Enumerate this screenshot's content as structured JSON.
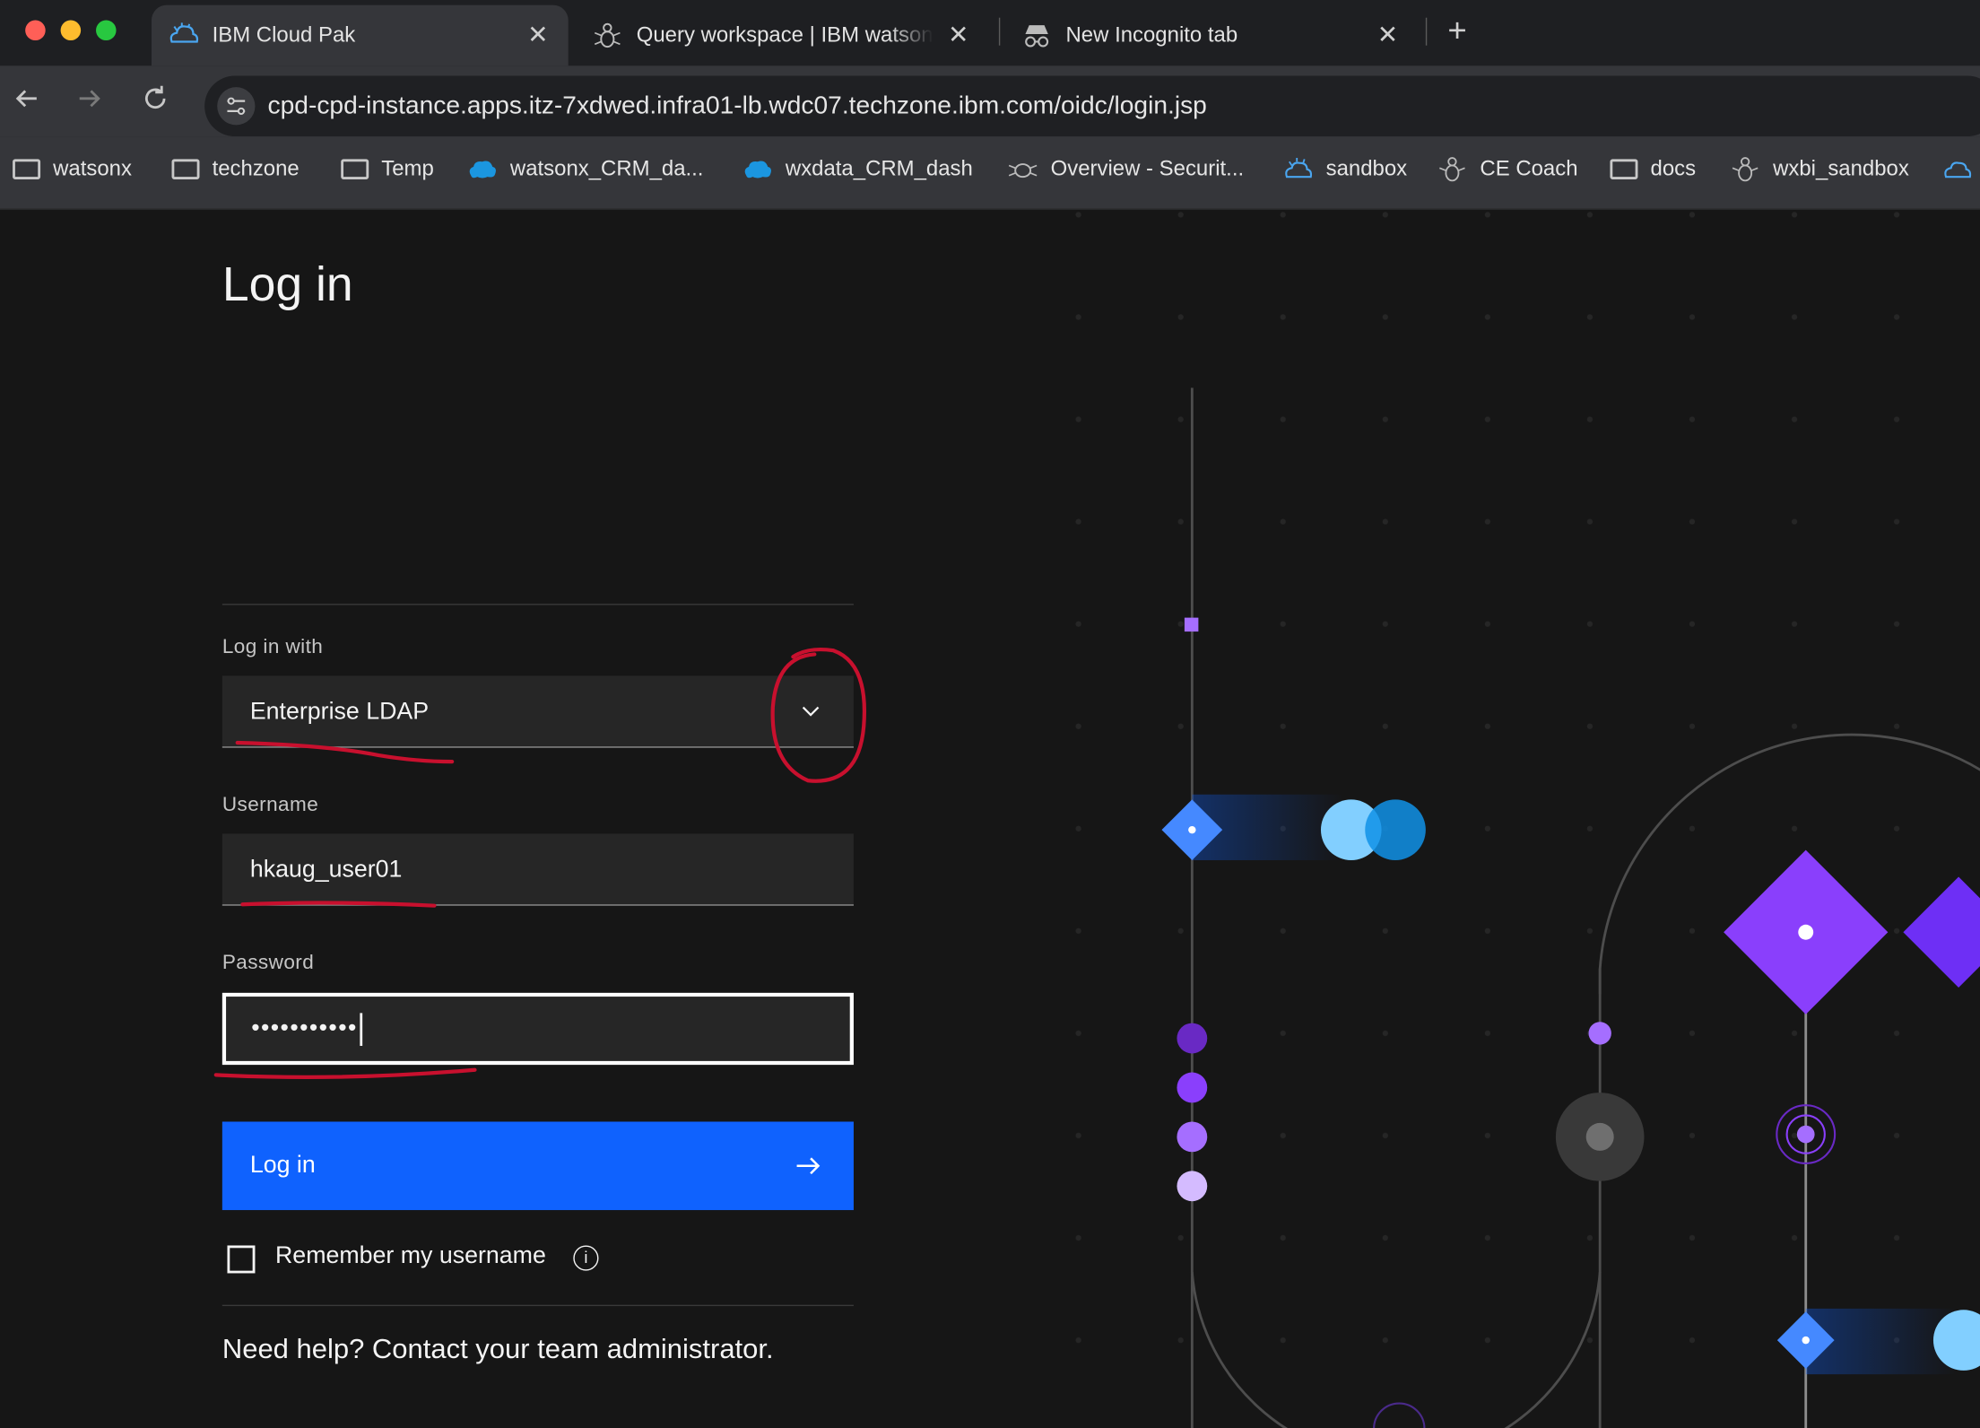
{
  "browser": {
    "tabs": [
      {
        "label": "IBM Cloud Pak",
        "icon": "ibm-cloud-icon",
        "active": true
      },
      {
        "label": "Query workspace | IBM watsonx",
        "icon": "watsonx-bee-icon",
        "active": false
      },
      {
        "label": "New Incognito tab",
        "icon": "incognito-icon",
        "active": false
      }
    ],
    "url": "cpd-cpd-instance.apps.itz-7xdwed.infra01-lb.wdc07.techzone.ibm.com/oidc/login.jsp",
    "bookmarks": [
      {
        "label": "watsonx",
        "icon": "folder-icon"
      },
      {
        "label": "techzone",
        "icon": "folder-icon"
      },
      {
        "label": "Temp",
        "icon": "folder-icon"
      },
      {
        "label": "watsonx_CRM_da...",
        "icon": "salesforce-cloud-icon"
      },
      {
        "label": "wxdata_CRM_dash",
        "icon": "salesforce-cloud-icon"
      },
      {
        "label": "Overview - Securit...",
        "icon": "bee-icon"
      },
      {
        "label": "sandbox",
        "icon": "ibm-cloud-icon"
      },
      {
        "label": "CE Coach",
        "icon": "bee-icon"
      },
      {
        "label": "docs",
        "icon": "folder-icon"
      },
      {
        "label": "wxbi_sandbox",
        "icon": "bee-icon"
      }
    ]
  },
  "login": {
    "title": "Log in",
    "login_with_label": "Log in with",
    "login_with_value": "Enterprise LDAP",
    "username_label": "Username",
    "username_value": "hkaug_user01",
    "password_label": "Password",
    "password_value": "•••••••••••",
    "submit_label": "Log in",
    "remember_label": "Remember my username",
    "help_text": "Need help? Contact your team administrator."
  },
  "colors": {
    "primary_button": "#0f62fe",
    "background": "#161616",
    "annotation": "#c8102e"
  }
}
